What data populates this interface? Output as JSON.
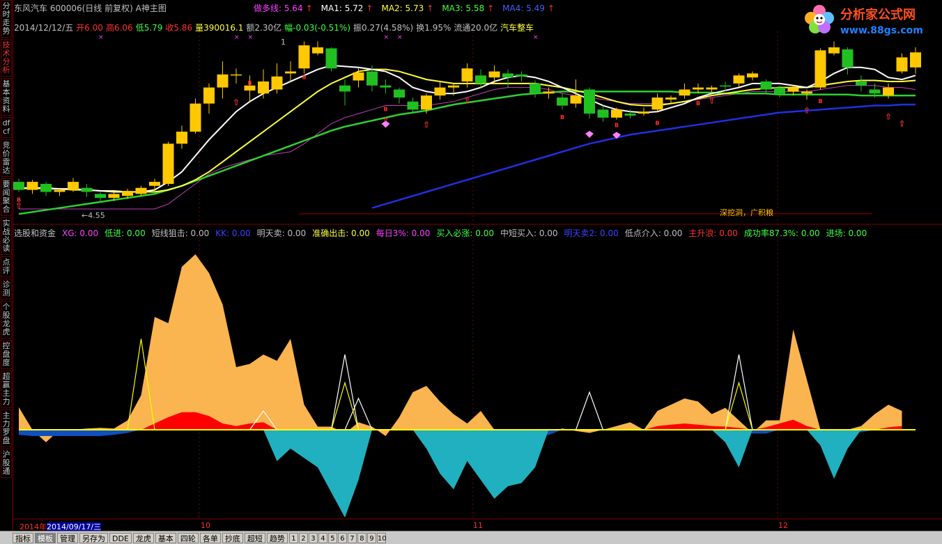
{
  "sidebar": {
    "items": [
      {
        "label": "分时走势",
        "active": false
      },
      {
        "label": "技术分析",
        "active": true
      },
      {
        "label": "基本资料",
        "active": false
      },
      {
        "label": "dfcf",
        "active": false
      },
      {
        "label": "竞价雷达",
        "active": false
      },
      {
        "label": "要闻聚合",
        "active": false
      },
      {
        "label": "实战必读",
        "active": false
      },
      {
        "label": "点评",
        "active": false
      },
      {
        "label": "诊测",
        "active": false
      },
      {
        "label": "个股龙虎",
        "active": false
      },
      {
        "label": "控盘度",
        "active": false
      },
      {
        "label": "超赢主力",
        "active": false
      },
      {
        "label": "主力罗盘",
        "active": false
      },
      {
        "label": "沪股通",
        "active": false
      }
    ]
  },
  "header": {
    "stock": "东风汽车 600006(日线 前复权) A神主图",
    "ma": [
      {
        "label": "做多线: 5.64",
        "arrow": "↑",
        "color": "#ff40ff"
      },
      {
        "label": "MA1: 5.72",
        "arrow": "↑",
        "color": "#ffffff"
      },
      {
        "label": "MA2: 5.73",
        "arrow": "↑",
        "color": "#ffff40"
      },
      {
        "label": "MA3: 5.58",
        "arrow": "↑",
        "color": "#40ff40"
      },
      {
        "label": "MA4: 5.49",
        "arrow": "↑",
        "color": "#4060ff"
      }
    ],
    "quote": [
      {
        "text": "2014/12/12/五",
        "color": "#c0c0c0"
      },
      {
        "text": "开6.00",
        "color": "#ff3030"
      },
      {
        "text": "高6.06",
        "color": "#ff3030"
      },
      {
        "text": "低5.79",
        "color": "#40ff40"
      },
      {
        "text": "收5.86",
        "color": "#ff3030"
      },
      {
        "text": "量390016.1",
        "color": "#ffff40"
      },
      {
        "text": "额2.30亿",
        "color": "#c0c0c0"
      },
      {
        "text": "幅-0.03(-0.51%)",
        "color": "#40ff40"
      },
      {
        "text": "振0.27(4.58%)",
        "color": "#c0c0c0"
      },
      {
        "text": "换1.95%",
        "color": "#c0c0c0"
      },
      {
        "text": "流通20.0亿",
        "color": "#c0c0c0"
      },
      {
        "text": "汽车整车",
        "color": "#ffff40"
      }
    ]
  },
  "logo": {
    "name": "分析家公式网",
    "url": "www.88gs.com"
  },
  "annotations": {
    "low_price": "←4.55",
    "high_price": "1",
    "dig_text": "深挖洞，广积粮"
  },
  "sub_header": [
    {
      "text": "选股和资金",
      "color": "#c0c0c0"
    },
    {
      "text": "XG: 0.00",
      "color": "#ff40ff"
    },
    {
      "text": "低进: 0.00",
      "color": "#40ff40"
    },
    {
      "text": "短线狙击: 0.00",
      "color": "#c0c0c0"
    },
    {
      "text": "KK: 0.00",
      "color": "#4040ff"
    },
    {
      "text": "明天卖: 0.00",
      "color": "#c0c0c0"
    },
    {
      "text": "准确出击: 0.00",
      "color": "#ffff40"
    },
    {
      "text": "每日3%: 0.00",
      "color": "#ff40ff"
    },
    {
      "text": "买入必涨: 0.00",
      "color": "#40ff40"
    },
    {
      "text": "中短买入: 0.00",
      "color": "#c0c0c0"
    },
    {
      "text": "明天卖2: 0.00",
      "color": "#4040ff"
    },
    {
      "text": "低点介入: 0.00",
      "color": "#c0c0c0"
    },
    {
      "text": "主升浪: 0.00",
      "color": "#ff3030"
    },
    {
      "text": "成功率87.3%: 0.00",
      "color": "#40ff40"
    },
    {
      "text": "进场: 0.00",
      "color": "#40ff40"
    }
  ],
  "date_bar": {
    "year": "2014年",
    "selected": "2014/09/17/三"
  },
  "month_labels": [
    {
      "text": "10"
    },
    {
      "text": "11"
    },
    {
      "text": "12"
    }
  ],
  "bottom_bar": {
    "buttons": [
      {
        "label": "指标",
        "active": false
      },
      {
        "label": "模板",
        "active": true
      },
      {
        "label": "管理",
        "active": false
      },
      {
        "label": "另存为",
        "active": false
      },
      {
        "label": "DDE",
        "active": false
      },
      {
        "label": "龙虎",
        "active": false
      },
      {
        "label": "基本",
        "active": false
      },
      {
        "label": "四轮",
        "active": false
      },
      {
        "label": "各单",
        "active": false
      },
      {
        "label": "抄底",
        "active": false
      },
      {
        "label": "超短",
        "active": false
      },
      {
        "label": "趋势",
        "active": false
      }
    ],
    "numbers": [
      "1",
      "2",
      "3",
      "4",
      "5",
      "6",
      "7",
      "8",
      "9",
      "10"
    ]
  },
  "chart_data": {
    "type": "candlestick",
    "price_range": [
      4.45,
      6.15
    ],
    "candles": [
      [
        4.72,
        4.64,
        4.75,
        4.62
      ],
      [
        4.64,
        4.72,
        4.74,
        4.6
      ],
      [
        4.7,
        4.62,
        4.72,
        4.58
      ],
      [
        4.62,
        4.64,
        4.66,
        4.58
      ],
      [
        4.64,
        4.72,
        4.76,
        4.62
      ],
      [
        4.66,
        4.62,
        4.7,
        4.57
      ],
      [
        4.6,
        4.56,
        4.62,
        4.52
      ],
      [
        4.56,
        4.6,
        4.62,
        4.53
      ],
      [
        4.58,
        4.63,
        4.65,
        4.55
      ],
      [
        4.6,
        4.66,
        4.68,
        4.58
      ],
      [
        4.68,
        4.72,
        4.75,
        4.62
      ],
      [
        4.7,
        5.1,
        5.12,
        4.68
      ],
      [
        5.1,
        5.22,
        5.28,
        5.05
      ],
      [
        5.22,
        5.5,
        5.55,
        5.2
      ],
      [
        5.5,
        5.66,
        5.7,
        5.4
      ],
      [
        5.66,
        5.79,
        5.92,
        5.55
      ],
      [
        5.78,
        5.79,
        5.85,
        5.7
      ],
      [
        5.63,
        5.68,
        5.78,
        5.52
      ],
      [
        5.6,
        5.72,
        5.84,
        5.55
      ],
      [
        5.64,
        5.77,
        5.9,
        5.6
      ],
      [
        5.8,
        5.82,
        5.92,
        5.72
      ],
      [
        5.85,
        6.08,
        6.12,
        5.8
      ],
      [
        6.0,
        6.06,
        6.12,
        5.98
      ],
      [
        6.05,
        5.85,
        6.06,
        5.82
      ],
      [
        5.68,
        5.62,
        5.74,
        5.48
      ],
      [
        5.73,
        5.81,
        5.86,
        5.66
      ],
      [
        5.82,
        5.68,
        5.88,
        5.62
      ],
      [
        5.68,
        5.66,
        5.74,
        5.6
      ],
      [
        5.64,
        5.56,
        5.66,
        5.5
      ],
      [
        5.52,
        5.44,
        5.56,
        5.4
      ],
      [
        5.44,
        5.58,
        5.6,
        5.4
      ],
      [
        5.58,
        5.66,
        5.72,
        5.54
      ],
      [
        5.66,
        5.68,
        5.7,
        5.58
      ],
      [
        5.72,
        5.85,
        5.9,
        5.66
      ],
      [
        5.78,
        5.7,
        5.84,
        5.66
      ],
      [
        5.76,
        5.82,
        5.88,
        5.7
      ],
      [
        5.8,
        5.76,
        5.84,
        5.66
      ],
      [
        5.79,
        5.77,
        5.82,
        5.72
      ],
      [
        5.7,
        5.6,
        5.73,
        5.56
      ],
      [
        5.6,
        5.62,
        5.66,
        5.55
      ],
      [
        5.56,
        5.48,
        5.6,
        5.44
      ],
      [
        5.5,
        5.58,
        5.74,
        5.46
      ],
      [
        5.64,
        5.4,
        5.66,
        5.35
      ],
      [
        5.44,
        5.36,
        5.48,
        5.32
      ],
      [
        5.36,
        5.44,
        5.46,
        5.34
      ],
      [
        5.4,
        5.38,
        5.44,
        5.35
      ],
      [
        5.4,
        5.42,
        5.46,
        5.38
      ],
      [
        5.44,
        5.56,
        5.6,
        5.42
      ],
      [
        5.54,
        5.56,
        5.58,
        5.5
      ],
      [
        5.58,
        5.64,
        5.7,
        5.55
      ],
      [
        5.64,
        5.66,
        5.7,
        5.6
      ],
      [
        5.64,
        5.66,
        5.68,
        5.6
      ],
      [
        5.68,
        5.67,
        5.72,
        5.62
      ],
      [
        5.7,
        5.78,
        5.8,
        5.66
      ],
      [
        5.76,
        5.8,
        5.82,
        5.73
      ],
      [
        5.72,
        5.64,
        5.74,
        5.6
      ],
      [
        5.66,
        5.6,
        5.68,
        5.56
      ],
      [
        5.62,
        5.66,
        5.68,
        5.58
      ],
      [
        5.6,
        5.62,
        5.64,
        5.54
      ],
      [
        5.66,
        6.03,
        6.05,
        5.64
      ],
      [
        6.0,
        6.06,
        6.12,
        5.98
      ],
      [
        6.04,
        5.86,
        6.06,
        5.79
      ],
      [
        5.72,
        5.68,
        5.78,
        5.62
      ],
      [
        5.64,
        5.6,
        5.7,
        5.56
      ],
      [
        5.58,
        5.66,
        5.7,
        5.55
      ],
      [
        5.82,
        5.96,
        6.0,
        5.8
      ],
      [
        5.86,
        6.01,
        6.06,
        5.8
      ]
    ],
    "ma_white": [
      4.65,
      4.66,
      4.66,
      4.65,
      4.65,
      4.64,
      4.63,
      4.62,
      4.62,
      4.62,
      4.64,
      4.72,
      4.82,
      4.98,
      5.14,
      5.28,
      5.42,
      5.52,
      5.6,
      5.66,
      5.72,
      5.78,
      5.84,
      5.88,
      5.87,
      5.86,
      5.84,
      5.82,
      5.76,
      5.66,
      5.62,
      5.6,
      5.6,
      5.62,
      5.66,
      5.72,
      5.76,
      5.78,
      5.76,
      5.72,
      5.66,
      5.6,
      5.54,
      5.48,
      5.44,
      5.42,
      5.41,
      5.42,
      5.46,
      5.5,
      5.56,
      5.6,
      5.63,
      5.66,
      5.7,
      5.7,
      5.7,
      5.68,
      5.66,
      5.72,
      5.8,
      5.86,
      5.86,
      5.84,
      5.76,
      5.74,
      5.78
    ],
    "ma_yellow": [
      4.66,
      4.66,
      4.65,
      4.65,
      4.64,
      4.64,
      4.63,
      4.63,
      4.62,
      4.62,
      4.62,
      4.64,
      4.68,
      4.74,
      4.82,
      4.92,
      5.02,
      5.12,
      5.22,
      5.32,
      5.42,
      5.52,
      5.62,
      5.7,
      5.76,
      5.82,
      5.84,
      5.84,
      5.82,
      5.78,
      5.74,
      5.72,
      5.7,
      5.7,
      5.7,
      5.7,
      5.7,
      5.7,
      5.7,
      5.68,
      5.66,
      5.63,
      5.6,
      5.56,
      5.52,
      5.49,
      5.48,
      5.48,
      5.5,
      5.52,
      5.55,
      5.58,
      5.6,
      5.62,
      5.64,
      5.65,
      5.66,
      5.66,
      5.66,
      5.68,
      5.7,
      5.72,
      5.73,
      5.73,
      5.72,
      5.72,
      5.73
    ],
    "ma_green": [
      4.4,
      4.42,
      4.44,
      4.46,
      4.48,
      4.5,
      4.52,
      4.54,
      4.56,
      4.58,
      4.6,
      4.64,
      4.68,
      4.73,
      4.78,
      4.83,
      4.88,
      4.93,
      4.98,
      5.03,
      5.08,
      5.13,
      5.18,
      5.23,
      5.27,
      5.3,
      5.33,
      5.36,
      5.39,
      5.41,
      5.43,
      5.46,
      5.49,
      5.51,
      5.53,
      5.55,
      5.57,
      5.59,
      5.6,
      5.61,
      5.62,
      5.62,
      5.62,
      5.62,
      5.62,
      5.62,
      5.62,
      5.62,
      5.62,
      5.61,
      5.61,
      5.61,
      5.6,
      5.6,
      5.6,
      5.6,
      5.59,
      5.59,
      5.59,
      5.59,
      5.59,
      5.59,
      5.58,
      5.58,
      5.58,
      5.58,
      5.58
    ],
    "ma_blue": [
      null,
      null,
      null,
      null,
      null,
      null,
      null,
      null,
      null,
      null,
      null,
      null,
      null,
      null,
      null,
      null,
      null,
      null,
      null,
      null,
      null,
      null,
      null,
      null,
      null,
      null,
      4.46,
      4.5,
      4.54,
      4.58,
      4.62,
      4.66,
      4.7,
      4.74,
      4.78,
      4.82,
      4.86,
      4.9,
      4.94,
      4.98,
      5.02,
      5.06,
      5.1,
      5.13,
      5.16,
      5.19,
      5.21,
      5.23,
      5.25,
      5.27,
      5.29,
      5.31,
      5.33,
      5.35,
      5.37,
      5.39,
      5.41,
      5.42,
      5.43,
      5.44,
      5.45,
      5.46,
      5.47,
      5.48,
      5.48,
      5.49,
      5.49
    ],
    "ma_magenta": [
      4.45,
      4.45,
      4.45,
      4.45,
      4.45,
      4.45,
      4.45,
      4.45,
      4.45,
      4.45,
      4.45,
      4.5,
      4.6,
      4.7,
      4.8,
      4.86,
      4.9,
      4.94,
      4.98,
      5.0,
      5.02,
      5.1,
      5.2,
      5.3,
      5.36,
      5.4,
      5.44,
      5.48,
      5.48,
      5.48,
      5.48,
      5.5,
      5.52,
      5.56,
      5.6,
      5.64,
      5.66,
      5.66,
      5.66,
      5.64,
      5.6,
      5.58,
      5.56,
      5.54,
      5.52,
      5.5,
      5.5,
      5.5,
      5.5,
      5.52,
      5.54,
      5.56,
      5.58,
      5.6,
      5.62,
      5.62,
      5.62,
      5.62,
      5.62,
      5.64,
      5.66,
      5.68,
      5.68,
      5.68,
      5.66,
      5.66,
      5.64
    ],
    "sub_orange": [
      0.36,
      0.0,
      -0.2,
      0.0,
      0.0,
      0.02,
      0.03,
      0.02,
      0.15,
      0.55,
      1.8,
      1.7,
      2.6,
      2.8,
      2.5,
      2.0,
      1.0,
      1.05,
      1.2,
      1.1,
      1.45,
      0.4,
      0.05,
      0.05,
      -0.06,
      0.12,
      0.05,
      -0.1,
      0.2,
      0.6,
      0.7,
      0.45,
      0.25,
      0.1,
      0.3,
      0.0,
      -0.1,
      -0.05,
      -0.1,
      -0.05,
      0.02,
      -0.02,
      -0.05,
      0.0,
      0.06,
      0.12,
      0.0,
      0.3,
      0.4,
      0.5,
      0.45,
      0.25,
      0.35,
      0.15,
      -0.05,
      0.15,
      0.15,
      1.6,
      0.8,
      0.0,
      -0.2,
      0.0,
      0.06,
      0.25,
      0.4,
      0.3
    ],
    "sub_red": [
      0,
      0,
      0,
      0,
      0,
      0,
      0,
      0,
      0,
      0,
      0.1,
      0.2,
      0.28,
      0.28,
      0.22,
      0.1,
      0.06,
      0.1,
      0.12,
      0.0,
      0,
      0,
      0,
      0,
      0,
      0,
      0,
      0,
      0,
      0,
      0,
      0,
      0,
      0,
      0,
      0,
      0,
      0,
      0,
      0,
      0,
      0,
      0,
      0,
      0,
      0,
      0,
      0.06,
      0.08,
      0.1,
      0.08,
      0.06,
      0.05,
      0.03,
      0.0,
      0.04,
      0.1,
      0.16,
      0.06,
      0,
      0,
      0,
      0,
      0,
      0.04,
      0.06
    ],
    "sub_blue": [
      -0.08,
      -0.1,
      -0.1,
      -0.1,
      -0.1,
      -0.1,
      -0.1,
      -0.08,
      -0.05,
      0,
      0,
      0,
      0,
      0,
      0,
      0,
      0,
      0,
      0,
      -0.05,
      -0.1,
      -0.14,
      -0.18,
      -0.22,
      -0.2,
      -0.12,
      0,
      0,
      0,
      0,
      0,
      -0.1,
      -0.14,
      -0.17,
      -0.15,
      -0.2,
      -0.2,
      -0.14,
      -0.12,
      -0.08,
      0,
      0,
      0,
      0,
      0,
      0,
      0,
      0,
      0,
      0,
      0,
      0,
      0,
      0,
      -0.06,
      -0.06,
      0,
      0,
      0,
      -0.06,
      -0.08,
      -0.06,
      -0.04,
      0,
      0,
      0
    ],
    "sub_cyan": [
      0,
      0,
      0,
      0,
      0,
      0,
      0,
      0,
      0,
      0,
      0,
      0,
      0,
      0,
      0,
      0,
      0,
      0,
      0,
      -0.5,
      -0.3,
      -0.45,
      -0.6,
      -1.0,
      -1.4,
      -0.8,
      0,
      0,
      0,
      0,
      -0.3,
      -0.7,
      -0.95,
      -0.5,
      -0.8,
      -1.1,
      -0.9,
      -0.85,
      -0.6,
      0,
      0,
      0,
      0,
      0,
      0,
      0,
      0,
      0,
      0,
      0,
      0,
      0,
      -0.2,
      -0.6,
      0,
      0,
      0,
      0,
      0,
      -0.25,
      -0.78,
      -0.3,
      0,
      0,
      0,
      0
    ],
    "signal_yellow": [
      0,
      0,
      0,
      0,
      0,
      0,
      0,
      0,
      0,
      1.45,
      0,
      0,
      0,
      0,
      0,
      0,
      0,
      0,
      0,
      0,
      0,
      0,
      0,
      0,
      0.75,
      0,
      0,
      0,
      0,
      0,
      0,
      0,
      0,
      0,
      0,
      0,
      0,
      0,
      0,
      0,
      0,
      0,
      0,
      0,
      0,
      0,
      0,
      0,
      0,
      0,
      0,
      0,
      0,
      0.75,
      0,
      0,
      0,
      0,
      0,
      0,
      0,
      0,
      0,
      0,
      0,
      0,
      0
    ],
    "signal_white": [
      0,
      0,
      0,
      0,
      0,
      0,
      0,
      0,
      0,
      0,
      0,
      0,
      0,
      0,
      0,
      0,
      0,
      0,
      0.3,
      0,
      0,
      0,
      0,
      0,
      1.2,
      0.5,
      0,
      0,
      0,
      0,
      0,
      0,
      0,
      0,
      0,
      0,
      0,
      0,
      0,
      0,
      0,
      0,
      0.6,
      0,
      0,
      0,
      0,
      0,
      0,
      0,
      0,
      0,
      0,
      1.2,
      0,
      0,
      0,
      0,
      0,
      0,
      0,
      0,
      0,
      0,
      0,
      0,
      0
    ],
    "sub_range": [
      -2.4,
      3.0
    ]
  }
}
